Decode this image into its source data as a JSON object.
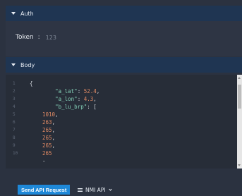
{
  "auth": {
    "header_label": "Auth",
    "token_label": "Token",
    "token_separator": ":",
    "token_value": "123"
  },
  "body": {
    "header_label": "Body",
    "line_numbers": [
      "1",
      "2",
      "3",
      "4",
      "5",
      "6",
      "7",
      "8",
      "9",
      "10"
    ],
    "code": {
      "open_brace": "{",
      "a_lat_key": "\"a_lat\"",
      "a_lat_value": "52.4",
      "a_lon_key": "\"a_lon\"",
      "a_lon_value": "4.3",
      "b_lu_brp_key": "\"b_lu_brp\"",
      "array_open": "[",
      "items": [
        "1010",
        "263",
        "265",
        "265",
        "265",
        "265"
      ]
    }
  },
  "footer": {
    "send_button_label": "Send API Request",
    "api_select_label": "NMI API"
  },
  "colors": {
    "header_bg": "#1f3552",
    "accent_button": "#1e88d8",
    "json_key": "#86d3b9",
    "json_number": "#e08a64"
  },
  "icons": {
    "section_toggle": "caret-down-icon",
    "api_menu": "hamburger-icon",
    "api_dropdown": "chevron-down-icon"
  }
}
